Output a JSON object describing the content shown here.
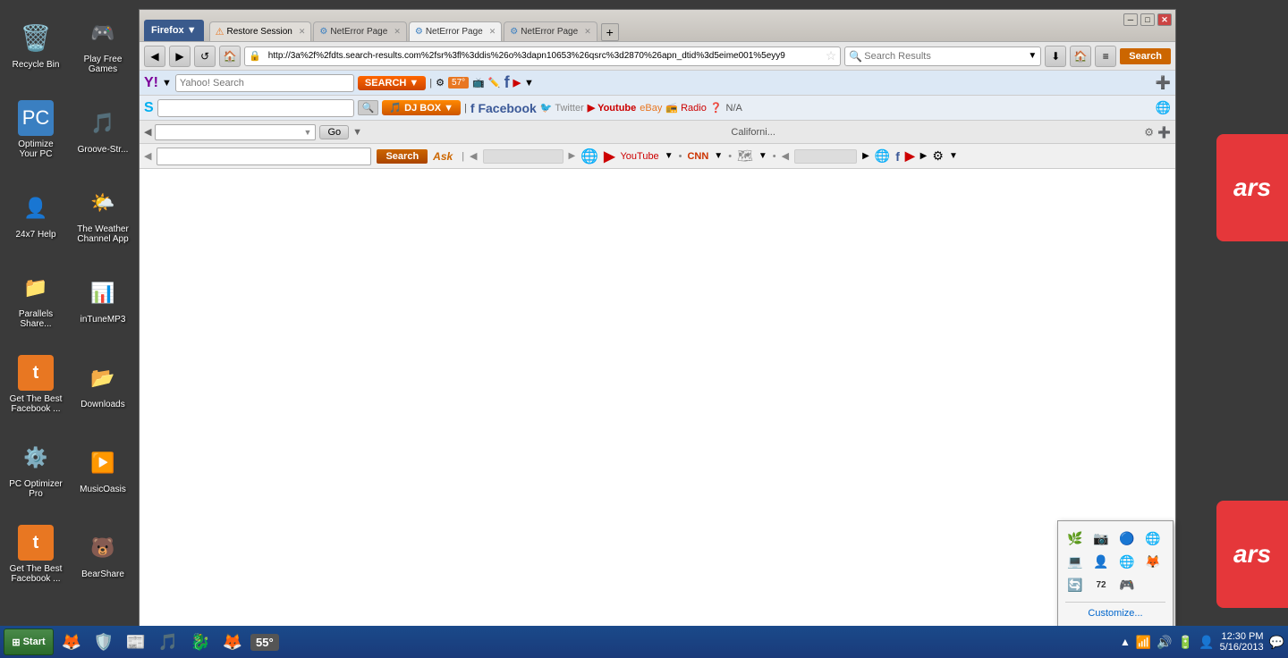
{
  "desktop": {
    "background_color": "#3a3a3a"
  },
  "desktop_icons": [
    {
      "id": "recycle-bin",
      "label": "Recycle Bin",
      "icon": "🗑️"
    },
    {
      "id": "optimize-pc",
      "label": "Optimize Your PC",
      "icon": "💻"
    },
    {
      "id": "24x7-help",
      "label": "24x7 Help",
      "icon": "👤"
    },
    {
      "id": "parallels-share",
      "label": "Parallels Share...",
      "icon": "📁"
    },
    {
      "id": "get-facebook-1",
      "label": "Get The Best Facebook ...",
      "icon": "t"
    },
    {
      "id": "pc-optimizer-pro",
      "label": "PC Optimizer Pro",
      "icon": "⚙️"
    },
    {
      "id": "get-facebook-2",
      "label": "Get The Best Facebook ...",
      "icon": "t"
    },
    {
      "id": "play-free-games",
      "label": "Play Free Games",
      "icon": "🎮"
    },
    {
      "id": "groove-str",
      "label": "Groove-Str...",
      "icon": "🎵"
    },
    {
      "id": "weather-channel",
      "label": "The Weather Channel App",
      "icon": "🌤️"
    },
    {
      "id": "intune-mp3",
      "label": "inTuneMP3",
      "icon": "📊"
    },
    {
      "id": "downloads",
      "label": "Downloads",
      "icon": "📂"
    },
    {
      "id": "music-oasis",
      "label": "MusicOasis",
      "icon": "▶️"
    },
    {
      "id": "bearshare",
      "label": "BearShare",
      "icon": "🐻"
    }
  ],
  "browser": {
    "title": "Firefox",
    "tabs": [
      {
        "label": "Restore Session",
        "icon": "⚠️",
        "type": "restore"
      },
      {
        "label": "NetError Page",
        "icon": "⚙️",
        "type": "neterror"
      },
      {
        "label": "NetError Page",
        "icon": "⚙️",
        "type": "neterror",
        "active": true
      },
      {
        "label": "NetError Page",
        "icon": "⚙️",
        "type": "neterror"
      }
    ],
    "url": "http://3a%2f%2fdts.search-results.com%2fsr%3fl%3ddis%26o%3dapn10653%26qsrc%3d2870%26apn_dtid%3d5eime001%5eyy9",
    "search_placeholder": "Search Results",
    "yahoo_search_placeholder": "Yahoo! Search",
    "skype_search_placeholder": "",
    "california_text": "Californi...",
    "temperature": "57°",
    "toolbars": {
      "bookmarks1": [
        "◀",
        "▶",
        "🌐",
        "YouTube",
        "▼",
        "•",
        "📘",
        "🐦",
        "📺",
        "eBay",
        "📻",
        "Radio",
        "❓",
        "N/A"
      ],
      "bookmarks2": [
        "◀",
        "▶",
        "🔍",
        "Search",
        "▶",
        "YouTube",
        "▶",
        "CNN",
        "▶",
        "🌐",
        "▶",
        "📘",
        "YouTube",
        "▶"
      ]
    }
  },
  "systray_popup": {
    "icons": [
      "🌿",
      "📷",
      "🔵",
      "🌐",
      "💻",
      "👤",
      "🌐",
      "🦊",
      "🔄",
      "🎮",
      "7️⃣2️⃣"
    ],
    "customize_label": "Customize..."
  },
  "taskbar": {
    "start_label": "Start",
    "temperature": "55°",
    "time": "12:30 PM",
    "date": "5/16/2013",
    "apps": [
      {
        "icon": "🦊",
        "label": "Firefox"
      },
      {
        "icon": "🛡️",
        "label": "Security"
      },
      {
        "icon": "📰",
        "label": "News"
      },
      {
        "icon": "🎵",
        "label": "Music"
      },
      {
        "icon": "🐉",
        "label": "App"
      },
      {
        "icon": "🦊",
        "label": "Firefox2"
      }
    ]
  },
  "ars_labels": [
    "ars",
    "ars"
  ],
  "search_btn": "Search"
}
